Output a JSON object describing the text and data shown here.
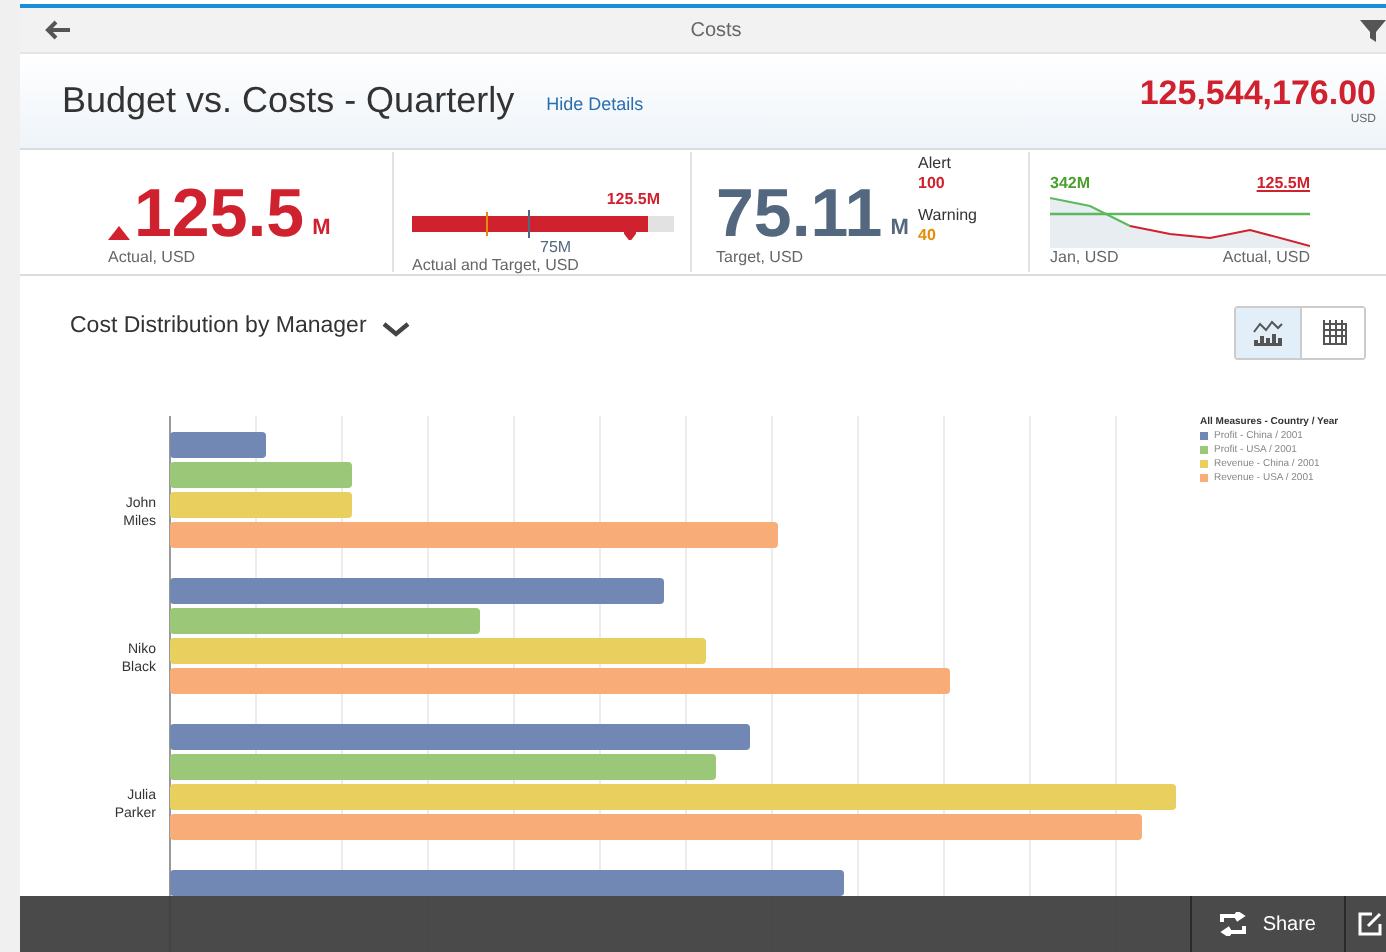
{
  "nav_bar": {
    "title": "Costs"
  },
  "header": {
    "title": "Budget vs. Costs - Quarterly",
    "link": "Hide Details",
    "total": "125,544,176.00",
    "currency": "USD"
  },
  "kpis": [
    {
      "kind": "number",
      "up_arrow": true,
      "value": "125.5",
      "unit": "M",
      "label": "Actual, USD",
      "color": "#d0212e"
    },
    {
      "kind": "bullet",
      "value": "125.5M",
      "target": "75M",
      "level": 0.9,
      "label": "Actual and Target, USD"
    },
    {
      "kind": "number",
      "up_arrow": false,
      "value": "75.11",
      "unit": "M",
      "label": "Target, USD",
      "color": "#53687e"
    },
    {
      "kind": "thresholds",
      "items": [
        {
          "label": "Alert",
          "value": "100",
          "color": "#d0212e"
        },
        {
          "label": "Warning",
          "value": "40",
          "color": "#e78c07"
        }
      ]
    },
    {
      "kind": "line",
      "start": "342M",
      "end": "125.5M",
      "start_label": "Jan, USD",
      "end_label": "Actual, USD"
    }
  ],
  "chart": {
    "title": "Cost Distribution by Manager",
    "views": [
      {
        "kind": "chart",
        "selected": true
      },
      {
        "kind": "table",
        "selected": false
      }
    ],
    "categories": [
      "John\nMiles",
      "Niko\nBlack",
      "Julia\nParker"
    ],
    "legend": {
      "title": "All Measures - Country / Year",
      "items": [
        {
          "label": "Profit - China / 2001",
          "color": "#7288b4"
        },
        {
          "label": "Profit - USA / 2001",
          "color": "#9bc878"
        },
        {
          "label": "Revenue - China / 2001",
          "color": "#e8cf5e"
        },
        {
          "label": "Revenue - USA / 2001",
          "color": "#f8ad78"
        }
      ]
    }
  },
  "footer": {
    "actions": [
      "Share"
    ]
  }
}
